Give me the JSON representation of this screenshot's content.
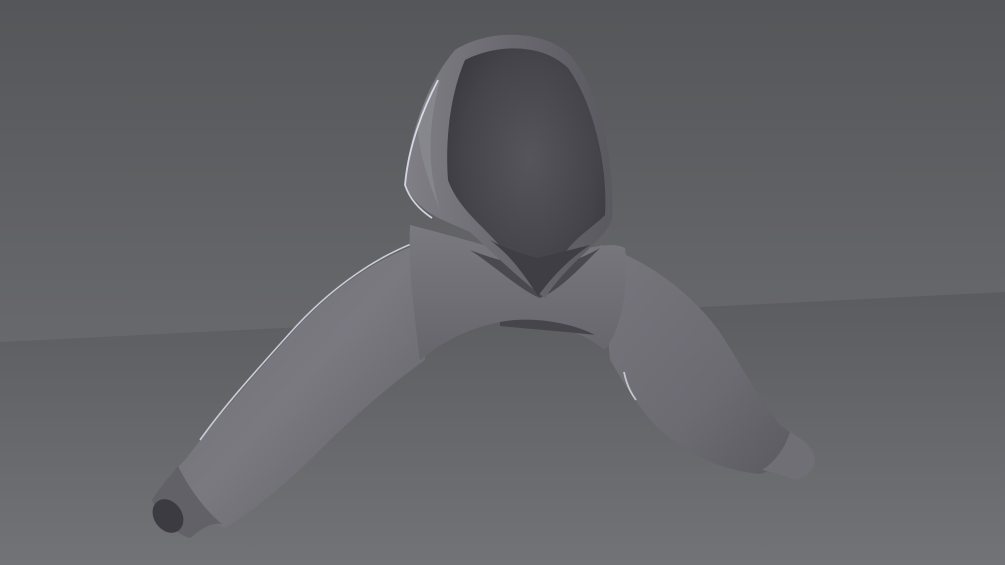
{
  "scene": {
    "subject": "hooded-cropped-jacket-3d-render",
    "colors": {
      "wall_top": "#56575a",
      "wall_bottom": "#66676a",
      "floor_near": "#6f7073",
      "floor_far": "#5c5d60",
      "garment_light": "#76757c",
      "garment_mid": "#64636a",
      "garment_dark": "#3e3d44",
      "rim_light": "#dfe3f0"
    }
  }
}
